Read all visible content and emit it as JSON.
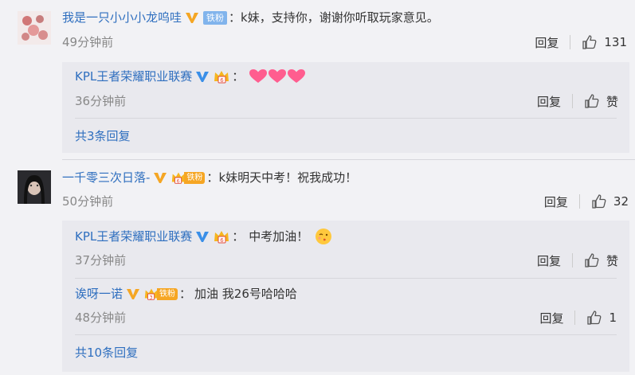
{
  "colors": {
    "link": "#2f6fbf",
    "background": "#f2f2f5",
    "reply_bg": "#e9e9ee"
  },
  "comments": [
    {
      "username": "我是一只小小小龙呜哇",
      "badge": "铁粉",
      "text": "k妹，支持你，谢谢你听取玩家意见。",
      "time": "49分钟前",
      "reply_label": "回复",
      "likes": "131",
      "replies": [
        {
          "username": "KPL王者荣耀职业联赛",
          "text": "",
          "emoji": "heart-emoji x3",
          "time": "36分钟前",
          "reply_label": "回复",
          "likes": "赞"
        }
      ],
      "more": "共3条回复"
    },
    {
      "username": "一千零三次日落-",
      "badge": "铁粉",
      "text": "k妹明天中考！祝我成功！",
      "time": "50分钟前",
      "reply_label": "回复",
      "likes": "32",
      "replies": [
        {
          "username": "KPL王者荣耀职业联赛",
          "text": "中考加油！",
          "emoji": "kiss-emoji",
          "time": "37分钟前",
          "reply_label": "回复",
          "likes": "赞"
        },
        {
          "username": "诶呀一诺",
          "badge": "铁粉",
          "badge_level": "3",
          "text": "加油 我26号哈哈哈",
          "time": "48分钟前",
          "reply_label": "回复",
          "likes": "1"
        }
      ],
      "more": "共10条回复"
    }
  ]
}
